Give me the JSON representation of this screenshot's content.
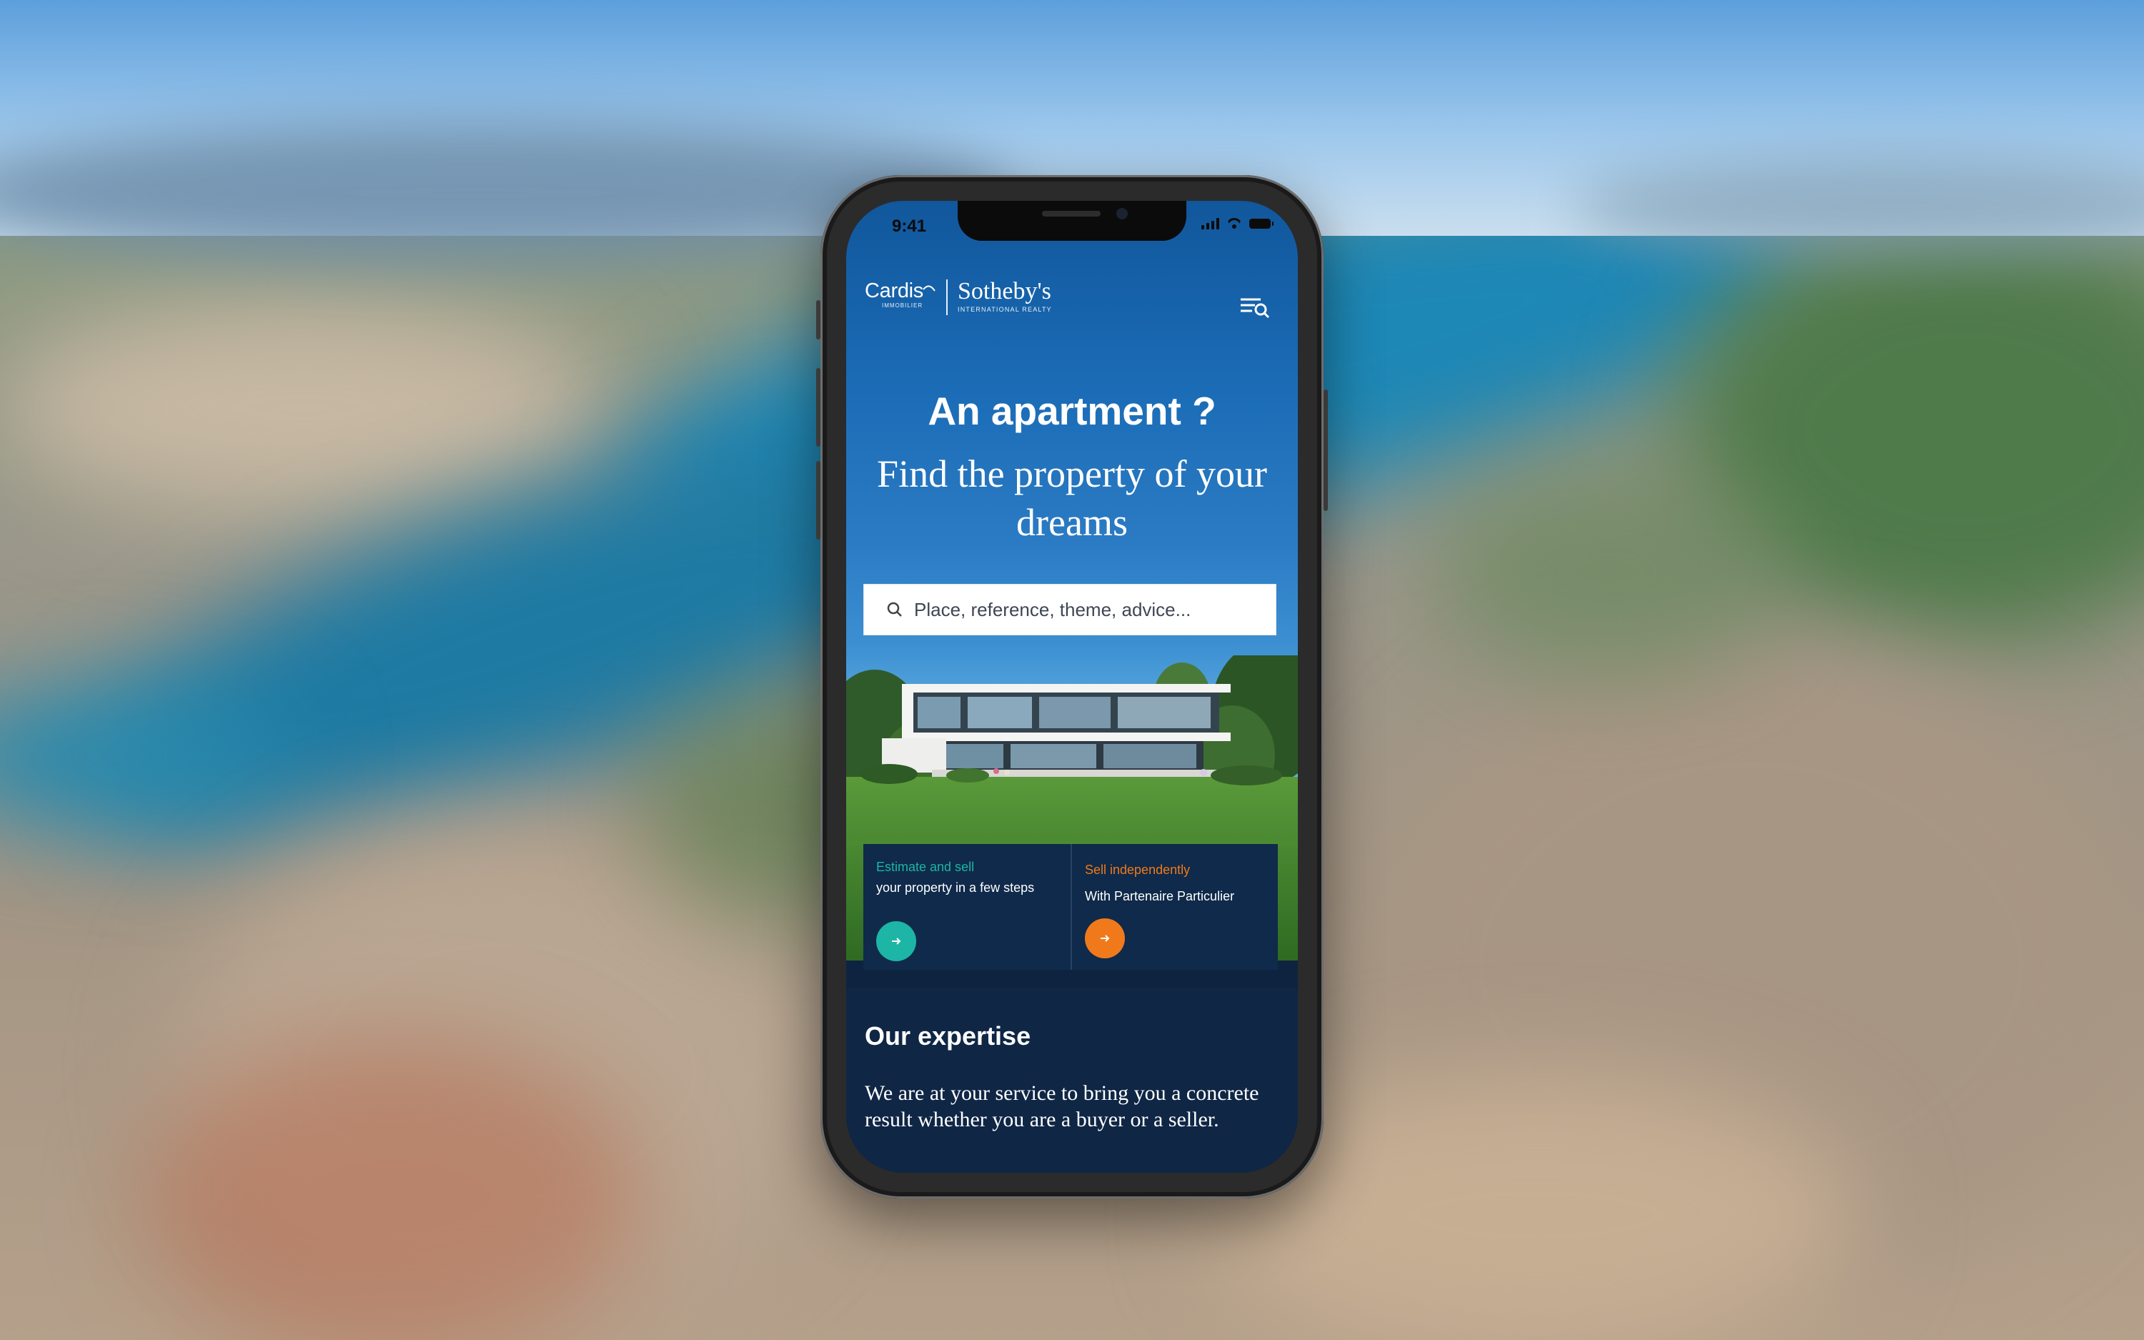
{
  "status_bar": {
    "time": "9:41"
  },
  "brand": {
    "cardis": "Cardis",
    "cardis_sub": "IMMOBILIER",
    "sothebys": "Sotheby's",
    "sothebys_sub": "INTERNATIONAL REALTY"
  },
  "hero": {
    "title": "An apartment ?",
    "subtitle": "Find the property of your dreams"
  },
  "search": {
    "placeholder": "Place, reference, theme, advice..."
  },
  "cards": [
    {
      "kicker": "Estimate and sell",
      "text": "your property in a few steps",
      "accent": "#1db5a6"
    },
    {
      "kicker": "Sell independently",
      "text": "With Partenaire Particulier",
      "accent": "#f07a1b"
    }
  ],
  "expertise": {
    "title": "Our expertise",
    "body": "We are at your service to bring you a concrete result whether you are a buyer or a seller."
  },
  "colors": {
    "header_blue": "#11579c",
    "navy": "#0f2645",
    "teal": "#1db5a6",
    "orange": "#f07a1b"
  }
}
